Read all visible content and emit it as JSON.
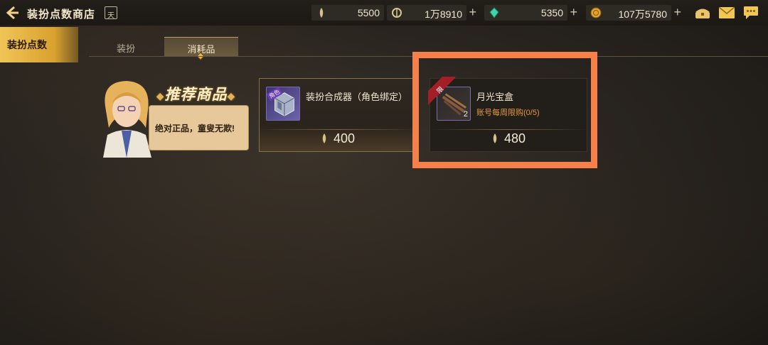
{
  "header": {
    "title": "装扮点数商店",
    "calendar_label": "天",
    "currencies": [
      {
        "name": "costume-points",
        "value": "5500",
        "has_plus": false
      },
      {
        "name": "cera",
        "value": "1万8910",
        "has_plus": true
      },
      {
        "name": "crystal",
        "value": "5350",
        "has_plus": true
      },
      {
        "name": "gold",
        "value": "107万5780",
        "has_plus": true
      }
    ],
    "plus": "+"
  },
  "sidebar": {
    "active_category": "装扮点数"
  },
  "tabs": [
    {
      "label": "装扮",
      "active": false
    },
    {
      "label": "消耗品",
      "active": true
    }
  ],
  "recommend": {
    "title": "推荐商品",
    "bubble_text": "绝对正品，童叟无欺!"
  },
  "items": [
    {
      "name": "装扮合成器（角色绑定）",
      "thumb_badge": "角色",
      "price": "400",
      "limit": ""
    },
    {
      "name": "月光宝盒",
      "ribbon": "限",
      "quantity": "2",
      "limit": "账号每周限购(0/5)",
      "price": "480"
    }
  ],
  "colors": {
    "accent_gold": "#f0c557",
    "highlight": "#f5804a",
    "limit_orange": "#e59a3a",
    "ribbon_red": "#a21f27"
  }
}
